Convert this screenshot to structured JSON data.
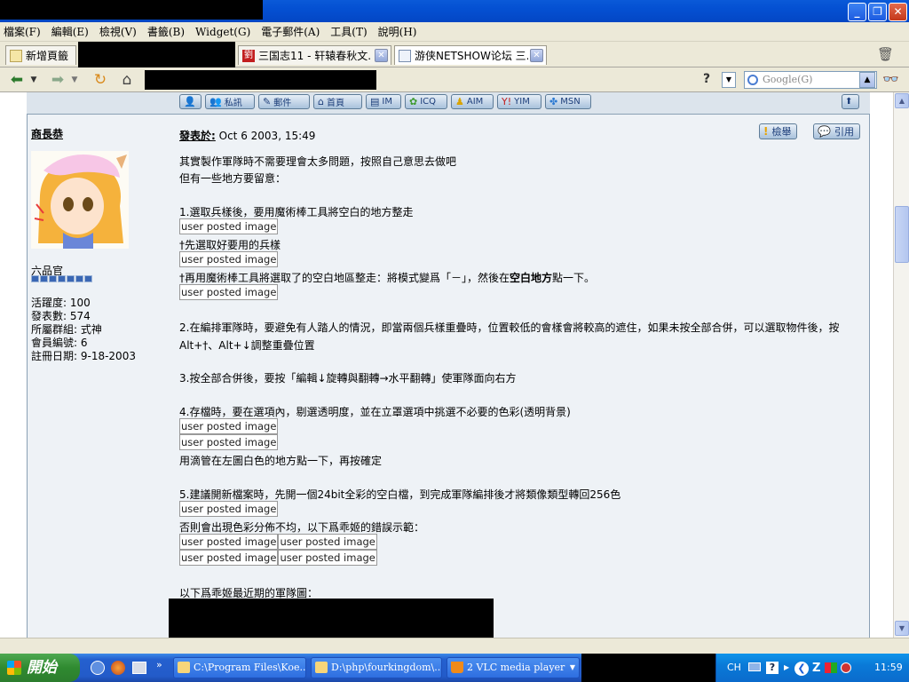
{
  "menu": [
    "檔案(F)",
    "編輯(E)",
    "檢視(V)",
    "書籤(B)",
    "Widget(G)",
    "電子郵件(A)",
    "工具(T)",
    "說明(H)"
  ],
  "tabs": [
    {
      "label": "新增頁籤"
    },
    {
      "label": "三国志11 - 轩辕春秋文..."
    },
    {
      "label": "游侠NETSHOW论坛 三..."
    }
  ],
  "search": {
    "placeholder": "Google(G)",
    "help": "?"
  },
  "topbar_buttons": [
    "私訊",
    "郵件",
    "首頁",
    "IM",
    "ICQ",
    "AIM",
    "YIM",
    "MSN"
  ],
  "post": {
    "author": "商長恭",
    "posted_label": "發表於:",
    "posted_date": "Oct 6 2003, 15:49",
    "rank": "六品官",
    "stats": [
      "活躍度: 100",
      "發表數: 574",
      "所屬群組: 式神",
      "會員編號: 6",
      "註冊日期: 9-18-2003"
    ],
    "actions": {
      "report": "檢舉",
      "quote": "引用"
    },
    "img_placeholder": "user posted image",
    "lines": {
      "l1": "其實製作軍隊時不需要理會太多問題，按照自己意思去做吧",
      "l2": "但有一些地方要留意：",
      "l3": "1.選取兵樣後，要用魔術棒工具將空白的地方整走",
      "l4": "†先選取好要用的兵樣",
      "l5a": "†再用魔術棒工具將選取了的空白地區整走：將模式變爲「－」，然後在",
      "l5b": "空白地方",
      "l5c": "點一下。",
      "l6": "2.在編排軍隊時，要避免有人踏人的情況，即當兩個兵樣重疊時，位置較低的會樣會將較高的遮住，如果未按全部合併，可以選取物件後，按",
      "l7": "Alt+†、Alt+↓調整重疊位置",
      "l8": "3.按全部合併後，要按「編輯↓旋轉與翻轉→水平翻轉」使軍隊面向右方",
      "l9": "4.存檔時，要在選項內，剔選透明度，並在立罩選項中挑選不必要的色彩(透明背景)",
      "l10": "用滴管在左圖白色的地方點一下，再按確定",
      "l11": "5.建議開新檔案時，先開一個24bit全彩的空白檔，到完成軍隊編排後才將類像類型轉回256色",
      "l12": "否則會出現色彩分佈不均，以下爲乖姬的錯誤示範：",
      "l13": "以下爲乖姬最近期的軍隊圖："
    }
  },
  "taskbar": {
    "start": "開始",
    "items": [
      "C:\\Program Files\\Koe...",
      "D:\\php\\fourkingdom\\...",
      "2 VLC media player"
    ],
    "tray_lang": "CH",
    "clock": "11:59"
  }
}
